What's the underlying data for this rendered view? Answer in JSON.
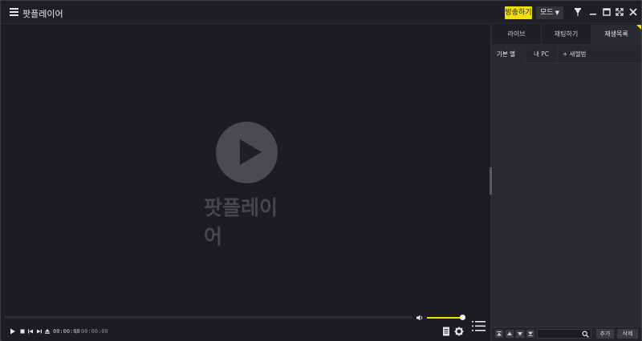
{
  "app": {
    "title": "팟플레이어"
  },
  "titlebar": {
    "broadcast_label": "방송하기",
    "mode_label": "모드",
    "mode_caret": "▼"
  },
  "video": {
    "brand_text": "팟플레이어"
  },
  "controls": {
    "current_time": "00:00:00",
    "separator": "/",
    "total_time": "00:00:00",
    "volume_level": 1.0
  },
  "panel": {
    "tabs": [
      {
        "label": "라이브"
      },
      {
        "label": "채팅하기"
      },
      {
        "label": "재생목록"
      }
    ],
    "subtabs": [
      {
        "label": "기본 앨범"
      },
      {
        "label": "내 PC"
      },
      {
        "label": "+ 새앨범"
      }
    ],
    "search_placeholder": "",
    "add_label": "추가",
    "delete_label": "삭제"
  },
  "colors": {
    "accent": "#f2e100",
    "background": "#1c1c22",
    "panel": "#2a2a31"
  },
  "icons": {
    "menu": "menu-icon",
    "pin": "pin-icon",
    "minimize": "minimize-icon",
    "maximize": "maximize-icon",
    "fullscreen": "fullscreen-icon",
    "close": "close-icon",
    "play": "play-icon",
    "stop": "stop-icon",
    "prev": "previous-icon",
    "next": "next-icon",
    "eject": "eject-icon",
    "volume": "volume-icon",
    "settings": "gear-icon",
    "playlist": "playlist-icon"
  }
}
